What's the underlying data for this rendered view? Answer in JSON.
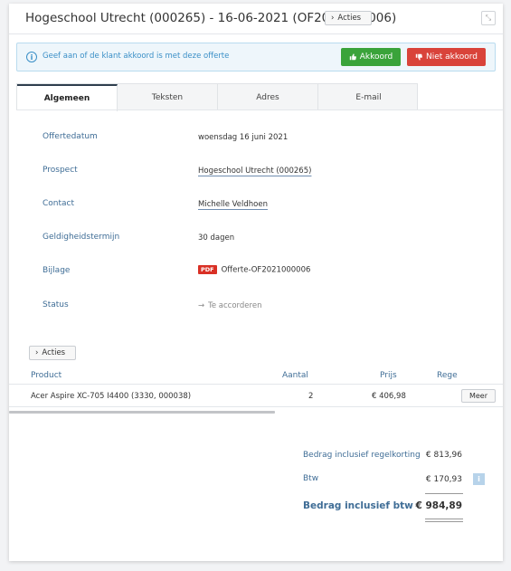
{
  "header": {
    "title": "Hogeschool Utrecht (000265) - 16-06-2021 (OF2021000006)",
    "actions_label": "Acties",
    "chevron": "›",
    "expand_glyph": "⤡"
  },
  "info_bar": {
    "text": "Geef aan of de klant akkoord is met deze offerte",
    "icon": "i",
    "approve_label": "Akkoord",
    "reject_label": "Niet akkoord",
    "approve_color": "#3aa33a",
    "reject_color": "#d9433a"
  },
  "tabs": [
    {
      "label": "Algemeen",
      "active": true
    },
    {
      "label": "Teksten",
      "active": false
    },
    {
      "label": "Adres",
      "active": false
    },
    {
      "label": "E-mail",
      "active": false
    }
  ],
  "details": {
    "offer_date": {
      "label": "Offertedatum",
      "value": "woensdag 16 juni 2021"
    },
    "prospect": {
      "label": "Prospect",
      "value": "Hogeschool Utrecht (000265)"
    },
    "contact": {
      "label": "Contact",
      "value": "Michelle Veldhoen"
    },
    "validity": {
      "label": "Geldigheidstermijn",
      "value": "30 dagen"
    },
    "attachment": {
      "label": "Bijlage",
      "badge": "PDF",
      "value": "Offerte-OF2021000006"
    },
    "status": {
      "label": "Status",
      "value": "Te accorderen",
      "arrow": "→"
    }
  },
  "lines": {
    "actions_label": "Acties",
    "columns": {
      "product": "Product",
      "qty": "Aantal",
      "price": "Prijs",
      "rule": "Rege"
    },
    "rows": [
      {
        "product": "Acer Aspire XC-705 I4400 (3330, 000038)",
        "qty": "2",
        "price": "€ 406,98",
        "more": "Meer"
      }
    ]
  },
  "totals": {
    "incl_discount": {
      "label": "Bedrag inclusief regelkorting",
      "value": "€ 813,96"
    },
    "vat": {
      "label": "Btw",
      "value": "€ 170,93",
      "info": "i"
    },
    "incl_vat": {
      "label": "Bedrag inclusief btw",
      "value": "€ 984,89"
    }
  }
}
